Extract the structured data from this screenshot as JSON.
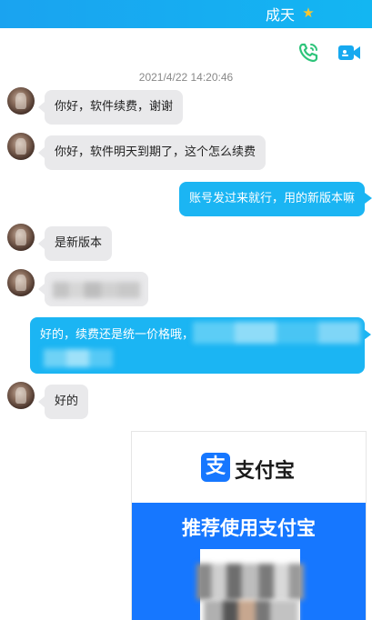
{
  "header": {
    "contact_name": "成天"
  },
  "toolbar": {
    "voice_call": "phone-call-icon",
    "video_call": "video-call-icon"
  },
  "conversation": {
    "timestamp": "2021/4/22 14:20:46",
    "messages": [
      {
        "direction": "incoming",
        "text": "你好，软件续费，谢谢"
      },
      {
        "direction": "incoming",
        "text": "你好，软件明天到期了，这个怎么续费"
      },
      {
        "direction": "outgoing",
        "text": "账号发过来就行，用的新版本嘛"
      },
      {
        "direction": "incoming",
        "text": "是新版本"
      },
      {
        "direction": "incoming",
        "text": ""
      },
      {
        "direction": "outgoing",
        "text": "好的，续费还是统一价格哦，"
      },
      {
        "direction": "incoming",
        "text": "好的"
      }
    ]
  },
  "payment_card": {
    "brand_icon": "支",
    "brand": "支付宝",
    "slogan": "推荐使用支付宝"
  },
  "colors": {
    "accent": "#1bb5f3",
    "incoming_bubble": "#e9e9eb",
    "alipay_blue": "#1677ff",
    "call_green": "#2ec47a"
  }
}
